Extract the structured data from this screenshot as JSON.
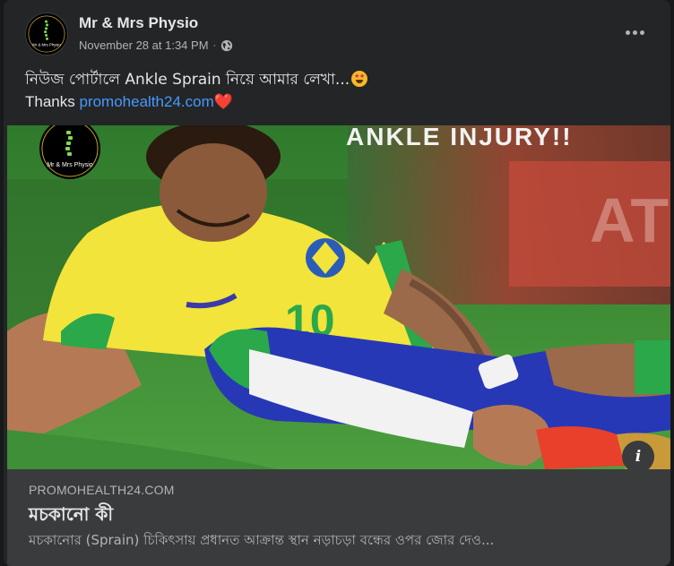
{
  "post": {
    "page_name": "Mr & Mrs Physio",
    "timestamp": "November 28 at 1:34 PM",
    "separator": "·",
    "privacy_icon": "globe-icon",
    "avatar_text": "Mr & Mrs Physio",
    "text_line1": "নিউজ পোর্টালে  Ankle Sprain নিয়ে আমার লেখা...",
    "text_line2_prefix": "Thanks ",
    "link_text": "promohealth24.com",
    "heart": "❤️"
  },
  "image": {
    "overlay_text": "ANKLE INJURY!!",
    "logo_text": "Mr & Mrs Physio"
  },
  "link_preview": {
    "domain": "PROMOHEALTH24.COM",
    "title": "মচকানো কী",
    "description": "মচকানোর (Sprain) চিকিৎসায় প্রধানত আক্রান্ত স্থান নড়াচড়া বন্ধের ওপর জোর দেও..."
  },
  "colors": {
    "background": "#242526",
    "link": "#4599ff",
    "muted": "#b0b3b8",
    "preview_bg": "#3a3b3c"
  }
}
